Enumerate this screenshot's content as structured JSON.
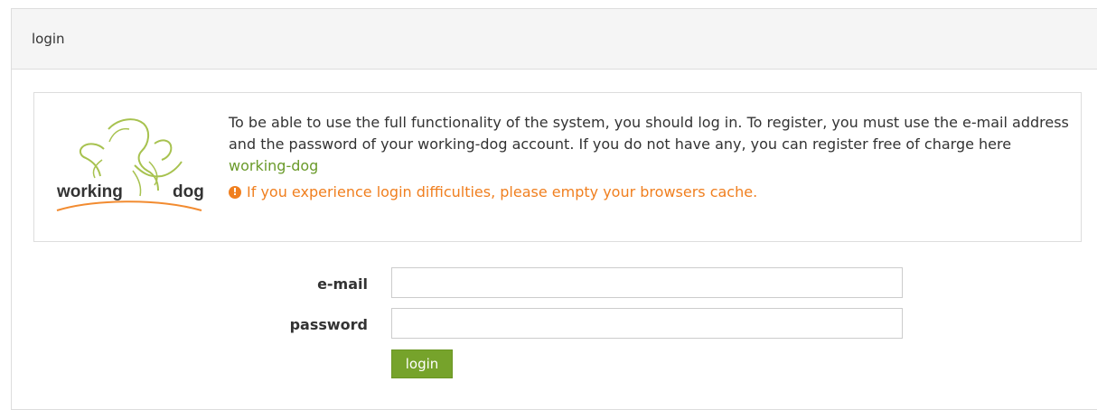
{
  "panel": {
    "title": "login"
  },
  "info": {
    "logo_text_left": "working",
    "logo_text_right": "dog",
    "message_prefix": "To be able to use the full functionality of the system, you should log in. To register, you must use the e-mail address and the password of your working-dog account. If you do not have any, you can register free of charge here ",
    "register_link": "working-dog",
    "warning_icon": "exclamation-circle-icon",
    "warning": "If you experience login difficulties, please empty your browsers cache."
  },
  "form": {
    "email_label": "e-mail",
    "email_value": "",
    "email_placeholder": "",
    "password_label": "password",
    "password_value": "",
    "password_placeholder": "",
    "submit_label": "login"
  },
  "colors": {
    "link": "#6a9a2a",
    "warning": "#f07f1f",
    "button": "#76a32b",
    "logo_green": "#a7c24f",
    "logo_orange": "#f28b30"
  }
}
